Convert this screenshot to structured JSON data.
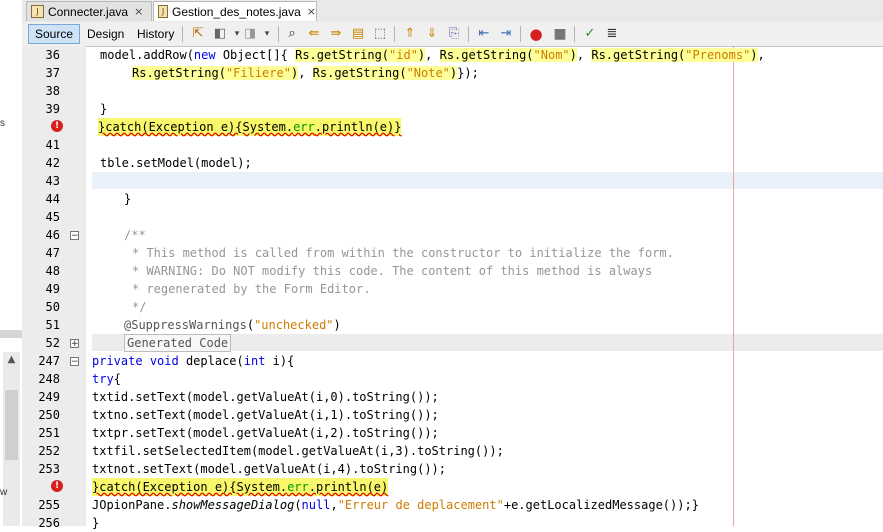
{
  "tabs": [
    {
      "label": "Connecter.java",
      "close": "×"
    },
    {
      "label": "Gestion_des_notes.java",
      "close": "×"
    }
  ],
  "toolbar": {
    "views": [
      "Source",
      "Design",
      "History"
    ],
    "icons": [
      "last-edit-icon",
      "back-icon",
      "forward-icon",
      "find-icon",
      "find-prev-icon",
      "find-next-icon",
      "toggle-highlight-icon",
      "toggle-rect-select-icon",
      "shift-left-icon",
      "shift-right-icon",
      "comment-icon",
      "uncomment-icon",
      "record-macro-icon",
      "stop-macro-icon",
      "diff-icon",
      "split-icon"
    ]
  },
  "left_panel": {
    "up_arrow": "▲",
    "marker": "s",
    "bottom_char": "w"
  },
  "lines": [
    {
      "num": "36",
      "text": "model.addRow(new Object[]{ Rs.getString(\"id\"), Rs.getString(\"Nom\"), Rs.getString(\"Prenoms\"),"
    },
    {
      "num": "37",
      "text": "Rs.getString(\"Filiere\"), Rs.getString(\"Note\")});"
    },
    {
      "num": "38",
      "text": ""
    },
    {
      "num": "39",
      "text": "}"
    },
    {
      "num": "",
      "text": "}catch(Exception e){System.err.println(e)}",
      "error": true
    },
    {
      "num": "41",
      "text": ""
    },
    {
      "num": "42",
      "text": "tble.setModel(model);"
    },
    {
      "num": "43",
      "text": ""
    },
    {
      "num": "44",
      "text": "}"
    },
    {
      "num": "45",
      "text": ""
    },
    {
      "num": "46",
      "text": "/**"
    },
    {
      "num": "47",
      "text": "* This method is called from within the constructor to initialize the form."
    },
    {
      "num": "48",
      "text": "* WARNING: Do NOT modify this code. The content of this method is always"
    },
    {
      "num": "49",
      "text": "* regenerated by the Form Editor."
    },
    {
      "num": "50",
      "text": "*/"
    },
    {
      "num": "51",
      "text": "@SuppressWarnings(\"unchecked\")"
    },
    {
      "num": "52",
      "text": "Generated Code"
    },
    {
      "num": "247",
      "text": "private void deplace(int i){"
    },
    {
      "num": "248",
      "text": "try{"
    },
    {
      "num": "249",
      "text": "txtid.setText(model.getValueAt(i,0).toString());"
    },
    {
      "num": "250",
      "text": "txtno.setText(model.getValueAt(i,1).toString());"
    },
    {
      "num": "251",
      "text": "txtpr.setText(model.getValueAt(i,2).toString());"
    },
    {
      "num": "252",
      "text": "txtfil.setSelectedItem(model.getValueAt(i,3).toString());"
    },
    {
      "num": "253",
      "text": "txtnot.setText(model.getValueAt(i,4).toString());"
    },
    {
      "num": "254",
      "text": "}catch(Exception e){System.err.println(e)"
    },
    {
      "num": "255",
      "text": "JOpionPane.showMessageDialog(null,\"Erreur de deplacement\"+e.getLocalizedMessage());}"
    },
    {
      "num": "256",
      "text": "}"
    }
  ],
  "colors": {
    "keyword": "#0000e6",
    "string": "#ce7b00",
    "comment": "#969696",
    "field": "#009900",
    "highlight": "#ffff33",
    "error": "#d62020"
  }
}
